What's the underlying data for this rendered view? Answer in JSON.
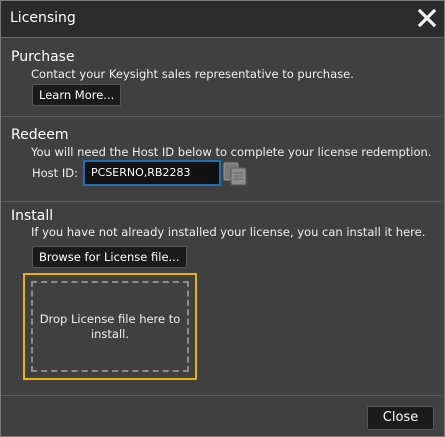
{
  "dialog": {
    "title": "Licensing",
    "close_icon": "close-x-icon"
  },
  "purchase": {
    "heading": "Purchase",
    "description": "Contact your Keysight sales representative to purchase.",
    "learn_more_label": "Learn More..."
  },
  "redeem": {
    "heading": "Redeem",
    "description": "You will need the Host ID below to complete your license redemption.",
    "host_id_label": "Host ID:",
    "host_id_value": "PCSERNO,RB2283",
    "copy_icon": "copy-icon"
  },
  "install": {
    "heading": "Install",
    "description": "If you have not already installed your license, you can install it here.",
    "browse_label": "Browse for License file...",
    "dropzone_text": "Drop License file here to install."
  },
  "footer": {
    "close_label": "Close"
  },
  "colors": {
    "dialog_bg": "#404040",
    "titlebar_bg": "#2c2c2c",
    "dropzone_border": "#e8b400",
    "field_border": "#1e6fb3"
  }
}
